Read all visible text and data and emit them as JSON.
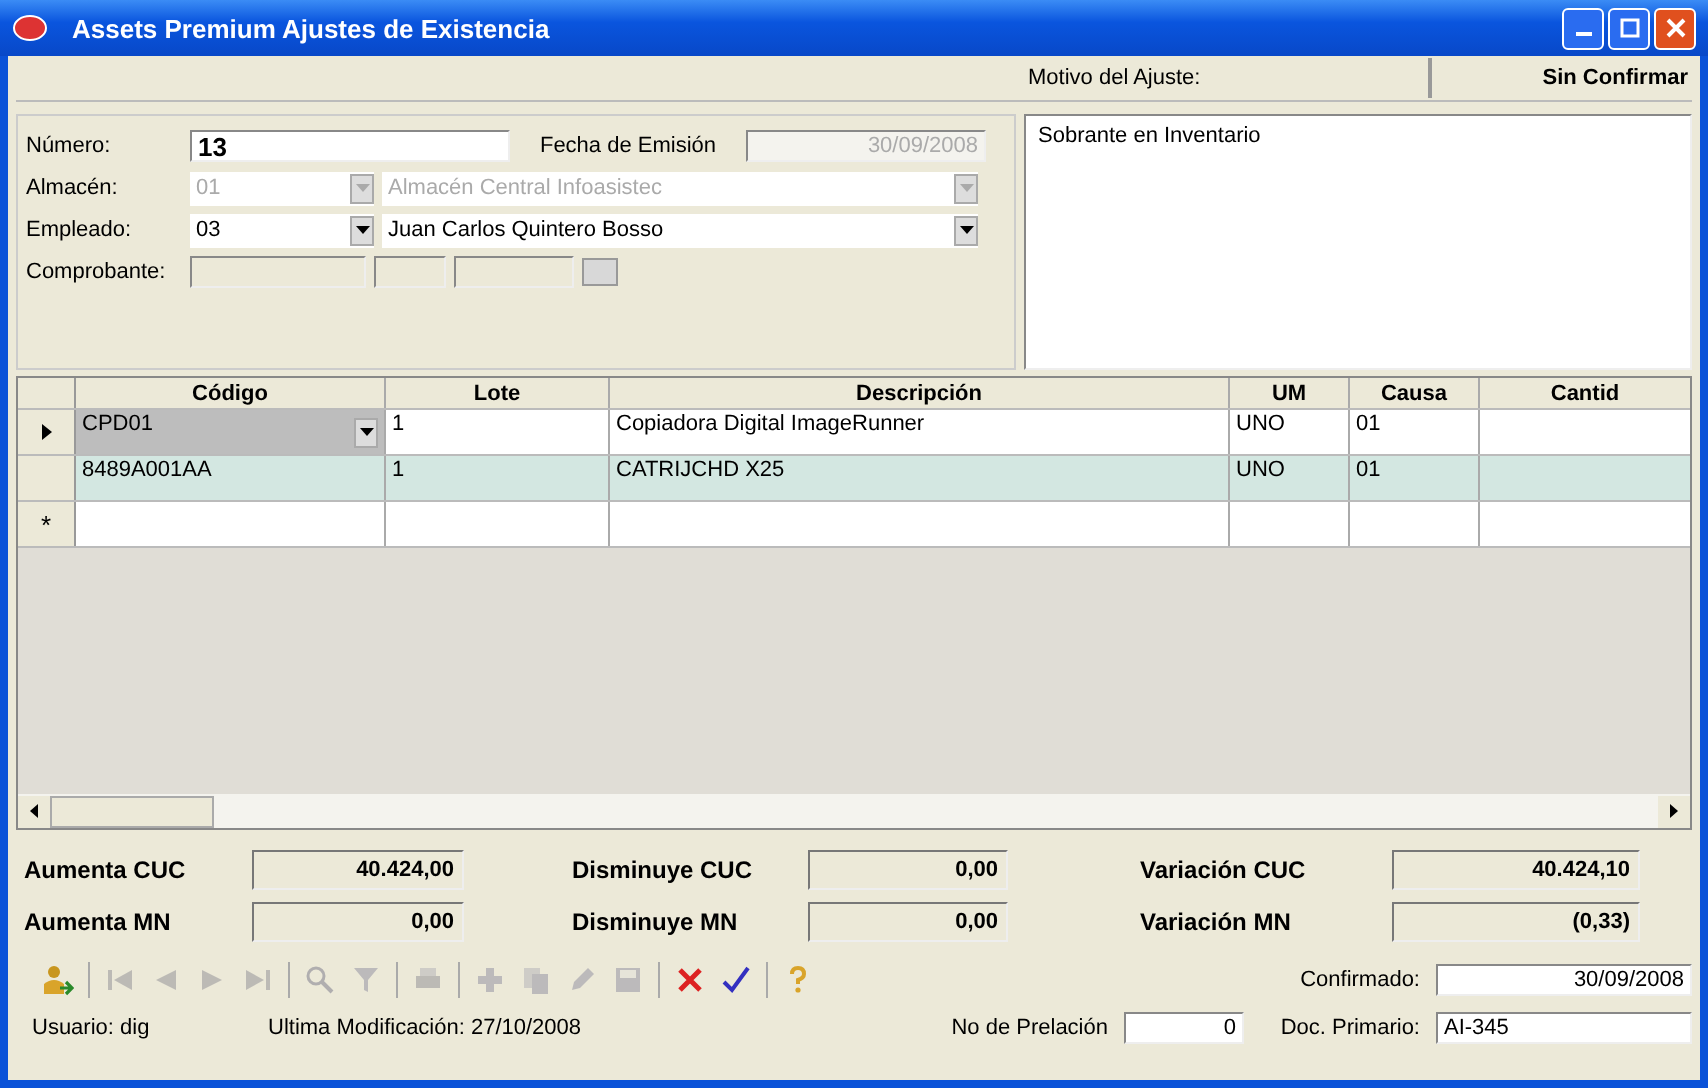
{
  "window": {
    "title": "Assets Premium Ajustes de Existencia"
  },
  "header": {
    "motivo_label": "Motivo del Ajuste:",
    "status": "Sin Confirmar"
  },
  "form": {
    "numero": {
      "label": "Número:",
      "value": "13"
    },
    "fecha": {
      "label": "Fecha de Emisión",
      "value": "30/09/2008",
      "disabled": true
    },
    "almacen": {
      "label": "Almacén:",
      "code": "01",
      "name": "Almacén Central Infoasistec",
      "disabled": true
    },
    "empleado": {
      "label": "Empleado:",
      "code": "03",
      "name": "Juan Carlos Quintero Bosso",
      "disabled": false
    },
    "comprobante": {
      "label": "Comprobante:"
    }
  },
  "motivo": {
    "value": "Sobrante en Inventario"
  },
  "table": {
    "columns": [
      "Código",
      "Lote",
      "Descripción",
      "UM",
      "Causa",
      "Cantid"
    ],
    "rows": [
      {
        "cells": [
          "CPD01",
          "1",
          "Copiadora Digital ImageRunner",
          "UNO",
          "01",
          ""
        ],
        "current": true,
        "selected": false
      },
      {
        "cells": [
          "8489A001AA",
          "1",
          "CATRIJCHD X25",
          "UNO",
          "01",
          ""
        ],
        "current": false,
        "selected": true
      }
    ],
    "new_row_marker": "*"
  },
  "totals": [
    {
      "label": "Aumenta CUC",
      "value": "40.424,00"
    },
    {
      "label": "Disminuye CUC",
      "value": "0,00"
    },
    {
      "label": "Variación CUC",
      "value": "40.424,10"
    },
    {
      "label": "Aumenta MN",
      "value": "0,00"
    },
    {
      "label": "Disminuye MN",
      "value": "0,00"
    },
    {
      "label": "Variación MN",
      "value": "(0,33)"
    }
  ],
  "toolbar": [
    {
      "kind": "import",
      "disabled": false
    },
    {
      "kind": "sep"
    },
    {
      "kind": "first",
      "disabled": true
    },
    {
      "kind": "prev",
      "disabled": true
    },
    {
      "kind": "next",
      "disabled": true
    },
    {
      "kind": "last",
      "disabled": true
    },
    {
      "kind": "sep"
    },
    {
      "kind": "search",
      "disabled": true
    },
    {
      "kind": "filter",
      "disabled": true
    },
    {
      "kind": "sep"
    },
    {
      "kind": "print",
      "disabled": true
    },
    {
      "kind": "sep"
    },
    {
      "kind": "add",
      "disabled": true
    },
    {
      "kind": "copy",
      "disabled": true
    },
    {
      "kind": "edit",
      "disabled": true
    },
    {
      "kind": "save",
      "disabled": true
    },
    {
      "kind": "sep"
    },
    {
      "kind": "delete",
      "disabled": false
    },
    {
      "kind": "confirm",
      "disabled": false
    },
    {
      "kind": "sep"
    },
    {
      "kind": "help",
      "disabled": false
    }
  ],
  "footer": {
    "usuario": "Usuario: dig",
    "modificacion": "Ultima Modificación: 27/10/2008",
    "prelacion": {
      "label": "No de Prelación",
      "value": "0"
    },
    "confirmado": {
      "label": "Confirmado:",
      "value": "30/09/2008"
    },
    "doc": {
      "label": "Doc. Primario:",
      "value": "AI-345"
    }
  }
}
